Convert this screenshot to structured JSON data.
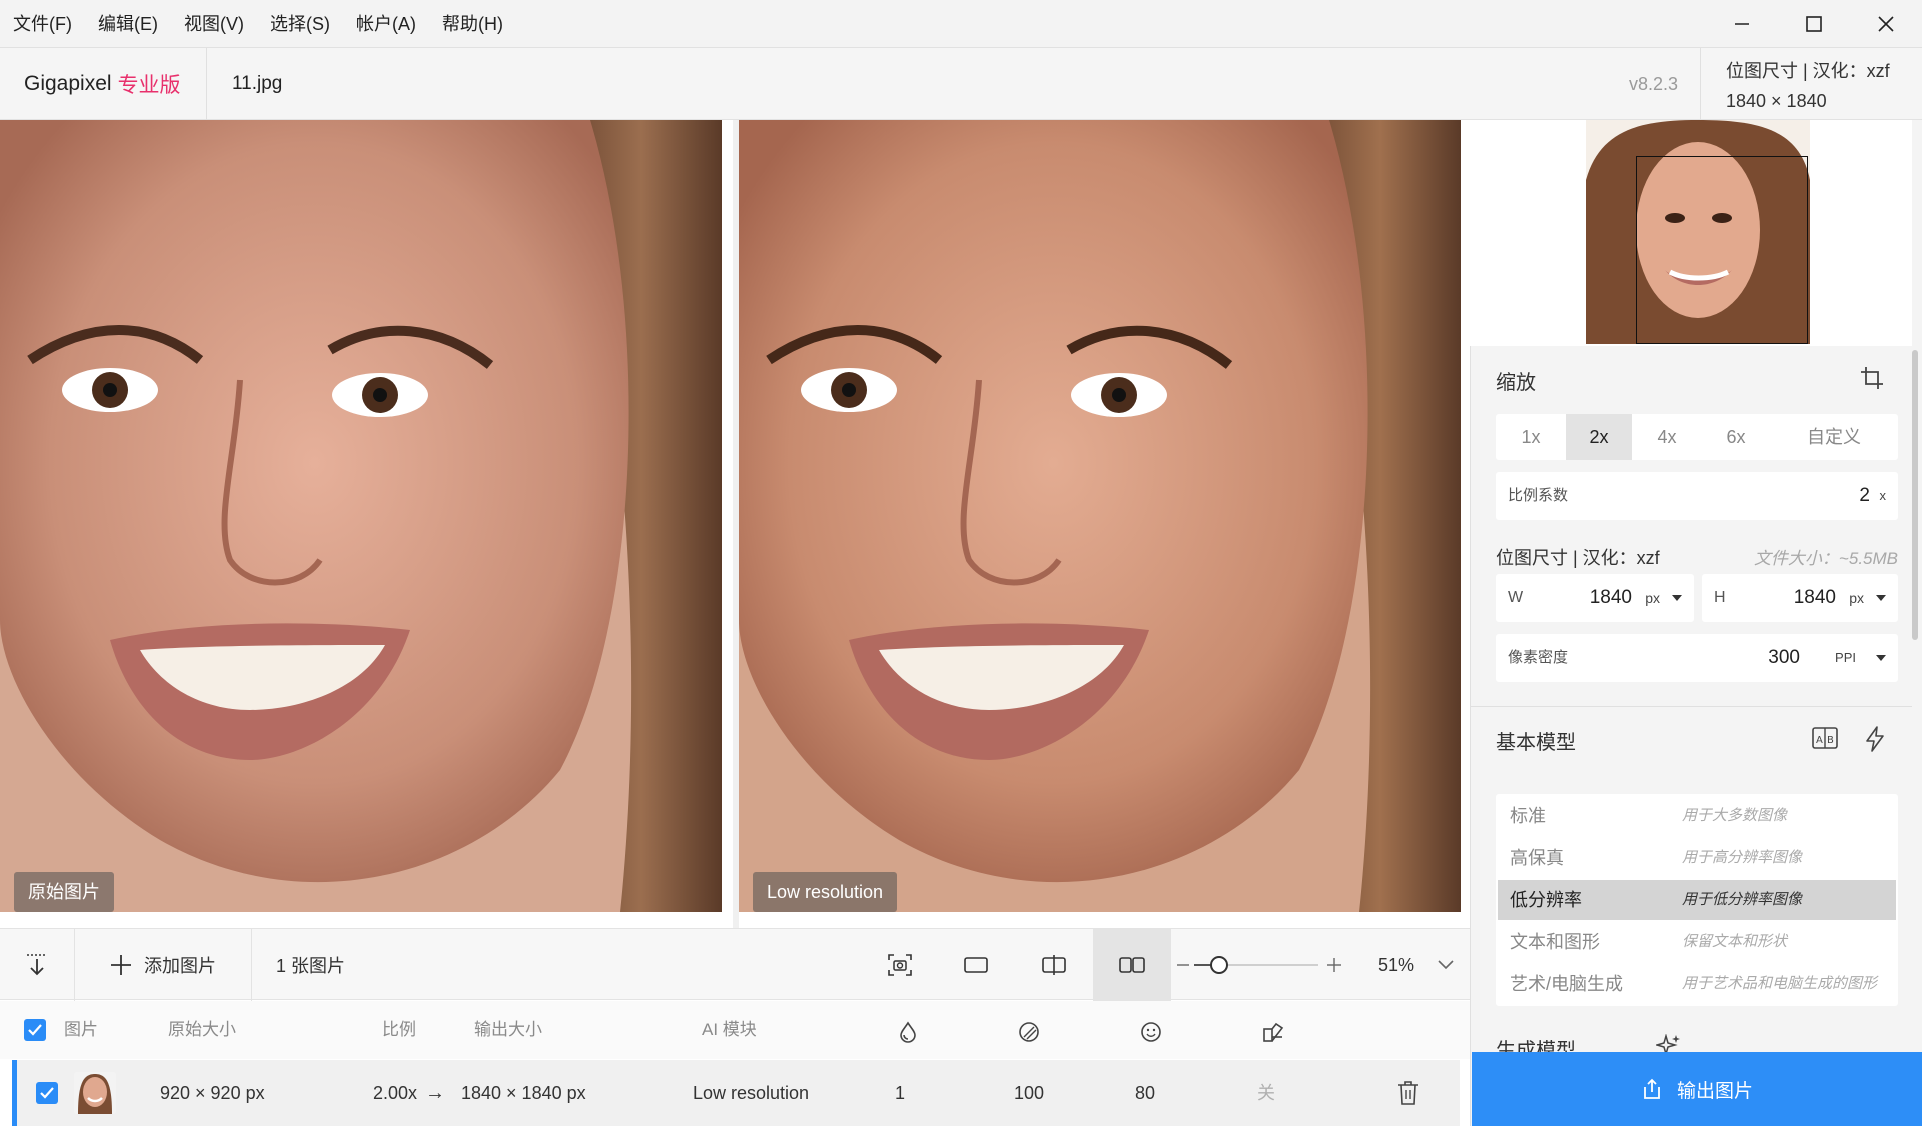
{
  "menu": [
    "文件(F)",
    "编辑(E)",
    "视图(V)",
    "选择(S)",
    "帐户(A)",
    "帮助(H)"
  ],
  "header": {
    "app_name": "Gigapixel",
    "edition": "专业版",
    "filename": "11.jpg",
    "version": "v8.2.3",
    "info_line1": "位图尺寸 | 汉化：xzf",
    "info_line2": "1840 × 1840"
  },
  "preview": {
    "left_label": "原始图片",
    "right_label": "Low resolution"
  },
  "toolbar": {
    "add_image": "添加图片",
    "image_count": "1 张图片",
    "zoom": "51%",
    "zoom_fraction": 0.2
  },
  "table": {
    "headers": {
      "image": "图片",
      "original": "原始大小",
      "scale": "比例",
      "output": "输出大小",
      "ai_model": "AI 模块"
    },
    "row": {
      "original": "920 × 920 px",
      "scale": "2.00x",
      "arrow": "→",
      "output": "1840 × 1840 px",
      "model": "Low resolution",
      "v1": "1",
      "v2": "100",
      "v3": "80",
      "v4": "关"
    }
  },
  "panel": {
    "scale_title": "缩放",
    "scale_options": [
      "1x",
      "2x",
      "4x",
      "6x",
      "自定义"
    ],
    "scale_factor_label": "比例系数",
    "scale_factor_value": "2",
    "scale_factor_unit": "x",
    "size_label": "位图尺寸 | 汉化：xzf",
    "file_size": "文件大小：~5.5MB",
    "w_label": "W",
    "w_value": "1840",
    "h_label": "H",
    "h_value": "1840",
    "px_unit": "px",
    "density_label": "像素密度",
    "density_value": "300",
    "density_unit": "PPI",
    "base_model_title": "基本模型",
    "models": [
      {
        "name": "标准",
        "desc": "用于大多数图像"
      },
      {
        "name": "高保真",
        "desc": "用于高分辨率图像"
      },
      {
        "name": "低分辨率",
        "desc": "用于低分辨率图像"
      },
      {
        "name": "文本和图形",
        "desc": "保留文本和形状"
      },
      {
        "name": "艺术/电脑生成",
        "desc": "用于艺术品和电脑生成的图形"
      }
    ],
    "gen_model_title": "生成模型",
    "export": "输出图片"
  },
  "colors": {
    "accent": "#2d8ef7",
    "brand_pink": "#e8306c"
  }
}
